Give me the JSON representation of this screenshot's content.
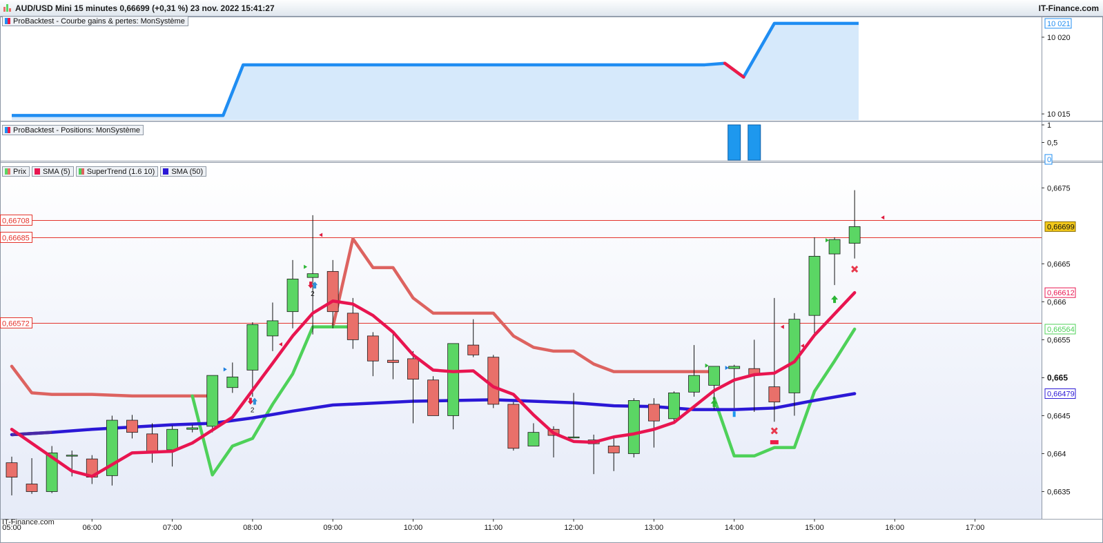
{
  "header": {
    "title": "AUD/USD Mini 15 minutes 0,66699 (+0,31 %) 23 nov. 2022 15:41:27",
    "brand": "IT-Finance.com"
  },
  "watermark": "IT-Finance.com",
  "panels": {
    "equity_label": "ProBacktest - Courbe gains & pertes: MonSystème",
    "positions_label": "ProBacktest - Positions: MonSystème"
  },
  "legend": {
    "price": "Prix",
    "sma5": "SMA (5)",
    "supertrend": "SuperTrend (1.6 10)",
    "sma50": "SMA (50)"
  },
  "colors": {
    "background": "#e6ebf8",
    "equity_line": "#1f8df2",
    "equity_fill": "#d6e9fb",
    "equity_loss": "#ee1b48",
    "bull_candle": "#5bd664",
    "bear_candle": "#e9706a",
    "sma5": "#e81550",
    "sma5_dark": "#c4123e",
    "sma50": "#2b18d6",
    "supertrend_up": "#4ed159",
    "supertrend_down": "#dd6360",
    "hline": "#e4332b",
    "position_bar": "#1e98ee"
  },
  "chart_data": [
    {
      "name": "equity",
      "type": "area",
      "y_ticks": [
        "10 020",
        "10 015"
      ],
      "current_value": "10 021",
      "x": [
        "05:00",
        "07:38",
        "07:53",
        "13:38",
        "13:53",
        "14:07",
        "14:30",
        "17:30"
      ],
      "values": [
        10014.9,
        10014.9,
        10018.2,
        10018.2,
        10018.3,
        10017.4,
        10020.9,
        10020.9
      ],
      "loss_segment": [
        "13:53",
        "14:07"
      ],
      "ylim": [
        10014.6,
        10021.3
      ]
    },
    {
      "name": "positions",
      "type": "bar",
      "y_ticks": [
        "1",
        "0,5"
      ],
      "current_value": "0",
      "bars": [
        {
          "x": "14:00",
          "value": 1
        },
        {
          "x": "14:15",
          "value": 1
        }
      ],
      "ylim": [
        0,
        1
      ]
    },
    {
      "name": "price",
      "type": "candlestick",
      "x_ticks": [
        "05:00",
        "06:00",
        "07:00",
        "08:00",
        "09:00",
        "10:00",
        "11:00",
        "12:00",
        "13:00",
        "14:00",
        "15:00",
        "16:00",
        "17:00"
      ],
      "y_ticks": [
        "0,6675",
        "0,6665",
        "0,666",
        "0,6655",
        "0,665",
        "0,6645",
        "0,664",
        "0,6635"
      ],
      "ylim": [
        0.66315,
        0.66783
      ],
      "current_price": "0,66699",
      "price_labels": [
        {
          "value": "0,66612",
          "color": "#e81550"
        },
        {
          "value": "0,66564",
          "color": "#4ed159"
        },
        {
          "value": "0,66479",
          "color": "#2b18d6"
        }
      ],
      "horizontal_lines": [
        {
          "label": "0,66708",
          "value": 0.66708
        },
        {
          "label": "0,66685",
          "value": 0.66685
        },
        {
          "label": "0,66572",
          "value": 0.66572
        }
      ],
      "candles": [
        {
          "t": "05:00",
          "o": 0.66388,
          "h": 0.66396,
          "l": 0.66345,
          "c": 0.66369
        },
        {
          "t": "05:15",
          "o": 0.6636,
          "h": 0.66394,
          "l": 0.66347,
          "c": 0.6635
        },
        {
          "t": "05:30",
          "o": 0.6635,
          "h": 0.6641,
          "l": 0.66348,
          "c": 0.66401
        },
        {
          "t": "05:45",
          "o": 0.66398,
          "h": 0.66404,
          "l": 0.6637,
          "c": 0.66398
        },
        {
          "t": "06:00",
          "o": 0.66393,
          "h": 0.66398,
          "l": 0.6636,
          "c": 0.66369
        },
        {
          "t": "06:15",
          "o": 0.66371,
          "h": 0.6645,
          "l": 0.66358,
          "c": 0.66444
        },
        {
          "t": "06:30",
          "o": 0.66444,
          "h": 0.66451,
          "l": 0.6642,
          "c": 0.66428
        },
        {
          "t": "06:45",
          "o": 0.66426,
          "h": 0.6644,
          "l": 0.66388,
          "c": 0.66403
        },
        {
          "t": "07:00",
          "o": 0.66405,
          "h": 0.66437,
          "l": 0.66383,
          "c": 0.66432
        },
        {
          "t": "07:15",
          "o": 0.66432,
          "h": 0.66438,
          "l": 0.66428,
          "c": 0.66434
        },
        {
          "t": "07:30",
          "o": 0.66436,
          "h": 0.66503,
          "l": 0.66428,
          "c": 0.66503
        },
        {
          "t": "07:45",
          "o": 0.66487,
          "h": 0.6652,
          "l": 0.6648,
          "c": 0.66501
        },
        {
          "t": "08:00",
          "o": 0.6651,
          "h": 0.66573,
          "l": 0.66475,
          "c": 0.6657
        },
        {
          "t": "08:15",
          "o": 0.66555,
          "h": 0.66599,
          "l": 0.66535,
          "c": 0.66575
        },
        {
          "t": "08:30",
          "o": 0.66587,
          "h": 0.66655,
          "l": 0.66565,
          "c": 0.6663
        },
        {
          "t": "08:45",
          "o": 0.66632,
          "h": 0.66714,
          "l": 0.66557,
          "c": 0.66637
        },
        {
          "t": "09:00",
          "o": 0.6664,
          "h": 0.66655,
          "l": 0.66565,
          "c": 0.66587
        },
        {
          "t": "09:15",
          "o": 0.66585,
          "h": 0.66605,
          "l": 0.66538,
          "c": 0.6655
        },
        {
          "t": "09:30",
          "o": 0.66555,
          "h": 0.6656,
          "l": 0.66502,
          "c": 0.66522
        },
        {
          "t": "09:45",
          "o": 0.66523,
          "h": 0.6656,
          "l": 0.66498,
          "c": 0.6652
        },
        {
          "t": "10:00",
          "o": 0.66525,
          "h": 0.66535,
          "l": 0.6644,
          "c": 0.66498
        },
        {
          "t": "10:15",
          "o": 0.66497,
          "h": 0.66502,
          "l": 0.6645,
          "c": 0.6645
        },
        {
          "t": "10:30",
          "o": 0.6645,
          "h": 0.66545,
          "l": 0.66432,
          "c": 0.66545
        },
        {
          "t": "10:45",
          "o": 0.66543,
          "h": 0.66577,
          "l": 0.66527,
          "c": 0.6653
        },
        {
          "t": "11:00",
          "o": 0.66527,
          "h": 0.6653,
          "l": 0.6646,
          "c": 0.66465
        },
        {
          "t": "11:15",
          "o": 0.66465,
          "h": 0.66468,
          "l": 0.66404,
          "c": 0.66407
        },
        {
          "t": "11:30",
          "o": 0.6641,
          "h": 0.6644,
          "l": 0.6641,
          "c": 0.66428
        },
        {
          "t": "11:45",
          "o": 0.66432,
          "h": 0.66436,
          "l": 0.66395,
          "c": 0.66424
        },
        {
          "t": "12:00",
          "o": 0.66422,
          "h": 0.6648,
          "l": 0.6642,
          "c": 0.66422
        },
        {
          "t": "12:15",
          "o": 0.66418,
          "h": 0.66425,
          "l": 0.66373,
          "c": 0.66413
        },
        {
          "t": "12:30",
          "o": 0.6641,
          "h": 0.6642,
          "l": 0.66377,
          "c": 0.66401
        },
        {
          "t": "12:45",
          "o": 0.664,
          "h": 0.66473,
          "l": 0.66395,
          "c": 0.6647
        },
        {
          "t": "13:00",
          "o": 0.66465,
          "h": 0.66473,
          "l": 0.66408,
          "c": 0.66443
        },
        {
          "t": "13:15",
          "o": 0.66446,
          "h": 0.66482,
          "l": 0.6644,
          "c": 0.6648
        },
        {
          "t": "13:30",
          "o": 0.66481,
          "h": 0.66543,
          "l": 0.66475,
          "c": 0.66503
        },
        {
          "t": "13:45",
          "o": 0.6649,
          "h": 0.66515,
          "l": 0.66458,
          "c": 0.66515
        },
        {
          "t": "14:00",
          "o": 0.66512,
          "h": 0.66517,
          "l": 0.6646,
          "c": 0.66515
        },
        {
          "t": "14:15",
          "o": 0.66512,
          "h": 0.6655,
          "l": 0.66455,
          "c": 0.66503
        },
        {
          "t": "14:30",
          "o": 0.66488,
          "h": 0.66605,
          "l": 0.66442,
          "c": 0.66468
        },
        {
          "t": "14:45",
          "o": 0.6648,
          "h": 0.66585,
          "l": 0.6645,
          "c": 0.66577
        },
        {
          "t": "15:00",
          "o": 0.66582,
          "h": 0.66685,
          "l": 0.66555,
          "c": 0.6666
        },
        {
          "t": "15:15",
          "o": 0.66663,
          "h": 0.66685,
          "l": 0.66622,
          "c": 0.66682
        },
        {
          "t": "15:30",
          "o": 0.66677,
          "h": 0.66747,
          "l": 0.66657,
          "c": 0.66699
        }
      ],
      "sma5": {
        "name": "SMA (5)",
        "x": [
          "05:00",
          "05:45",
          "06:00",
          "06:30",
          "07:00",
          "07:15",
          "07:45",
          "08:15",
          "08:30",
          "08:45",
          "09:00",
          "09:15",
          "09:30",
          "09:45",
          "10:00",
          "10:15",
          "10:30",
          "10:45",
          "11:00",
          "11:15",
          "11:30",
          "11:45",
          "12:00",
          "12:15",
          "12:30",
          "12:45",
          "13:00",
          "13:15",
          "13:30",
          "13:45",
          "14:00",
          "14:15",
          "14:30",
          "14:45",
          "15:00",
          "15:30"
        ],
        "values": [
          0.66432,
          0.66377,
          0.6637,
          0.66401,
          0.66403,
          0.66414,
          0.66448,
          0.66519,
          0.66555,
          0.66585,
          0.66601,
          0.66597,
          0.66582,
          0.6656,
          0.6653,
          0.6651,
          0.66508,
          0.66509,
          0.66488,
          0.66478,
          0.66451,
          0.66427,
          0.66416,
          0.66415,
          0.66422,
          0.66426,
          0.66432,
          0.66441,
          0.66462,
          0.66483,
          0.66497,
          0.66504,
          0.66506,
          0.66521,
          0.66556,
          0.66612
        ],
        "dark_range": [
          "05:00",
          "06:15"
        ]
      },
      "sma50": {
        "name": "SMA (50)",
        "x": [
          "05:00",
          "05:30",
          "06:00",
          "06:30",
          "07:00",
          "07:30",
          "08:00",
          "08:30",
          "09:00",
          "10:00",
          "11:00",
          "12:00",
          "12:30",
          "13:00",
          "13:30",
          "14:00",
          "14:30",
          "15:00",
          "15:30"
        ],
        "values": [
          0.66425,
          0.66428,
          0.66432,
          0.66435,
          0.66438,
          0.6644,
          0.66447,
          0.66456,
          0.66464,
          0.66469,
          0.66471,
          0.66467,
          0.66463,
          0.66462,
          0.66458,
          0.66458,
          0.6646,
          0.6647,
          0.66479
        ],
        "dark_range": [
          "05:00",
          "05:30"
        ]
      },
      "supertrend": {
        "name": "SuperTrend (1.6 10)",
        "down_segments": [
          {
            "x": [
              "05:00",
              "05:15",
              "05:30",
              "06:00",
              "06:30",
              "07:00",
              "07:15",
              "07:30"
            ],
            "values": [
              0.66515,
              0.6648,
              0.66478,
              0.66478,
              0.66476,
              0.66476,
              0.66476,
              0.66476
            ]
          },
          {
            "x": [
              "09:00",
              "09:15",
              "09:30",
              "09:45",
              "10:00",
              "10:15",
              "10:30",
              "10:45",
              "11:00",
              "11:15",
              "11:30",
              "11:45",
              "12:00",
              "12:15",
              "12:30",
              "12:45",
              "13:00",
              "13:15",
              "13:30",
              "13:45"
            ],
            "values": [
              0.66567,
              0.66683,
              0.66645,
              0.66645,
              0.66605,
              0.66585,
              0.66585,
              0.66585,
              0.66585,
              0.66555,
              0.6654,
              0.66535,
              0.66535,
              0.66518,
              0.66508,
              0.66508,
              0.66508,
              0.66508,
              0.66508,
              0.66508
            ]
          }
        ],
        "up_segments": [
          {
            "x": [
              "07:15",
              "07:30",
              "07:45",
              "08:00",
              "08:15",
              "08:30",
              "08:45",
              "09:00",
              "09:15"
            ],
            "values": [
              0.66476,
              0.66372,
              0.6641,
              0.6642,
              0.66465,
              0.66505,
              0.66567,
              0.66567,
              0.66567
            ]
          },
          {
            "x": [
              "13:45",
              "14:00",
              "14:15",
              "14:30",
              "14:45",
              "15:00",
              "15:15",
              "15:30"
            ],
            "values": [
              0.66473,
              0.66397,
              0.66397,
              0.66408,
              0.66408,
              0.66482,
              0.66522,
              0.66564
            ]
          }
        ]
      },
      "signals": [
        {
          "t": "08:00",
          "kind": "down-up-2",
          "value": 0.66469
        },
        {
          "t": "07:45",
          "kind": "tri-right-blue",
          "value": 0.66511
        },
        {
          "t": "08:15",
          "kind": "tri-left-red",
          "value": 0.66544
        },
        {
          "t": "08:45",
          "kind": "down-up-2",
          "value": 0.66622
        },
        {
          "t": "08:45",
          "kind": "tri-right-green",
          "value": 0.66646
        },
        {
          "t": "08:45",
          "kind": "tri-left-red",
          "value": 0.66688
        },
        {
          "t": "13:45",
          "kind": "up-green",
          "value": 0.66466
        },
        {
          "t": "13:45",
          "kind": "tri-right-green",
          "value": 0.66516
        },
        {
          "t": "14:00",
          "kind": "tri-right-blue",
          "value": 0.66513
        },
        {
          "t": "14:00",
          "kind": "bar-blue",
          "value": 0.66452
        },
        {
          "t": "14:30",
          "kind": "x-red",
          "value": 0.6643
        },
        {
          "t": "14:30",
          "kind": "rect-red",
          "value": 0.66415
        },
        {
          "t": "14:30",
          "kind": "tri-left-red",
          "value": 0.66567
        },
        {
          "t": "14:45",
          "kind": "tri-left-red",
          "value": 0.66542
        },
        {
          "t": "15:15",
          "kind": "tri-right-green",
          "value": 0.66681
        },
        {
          "t": "15:15",
          "kind": "up-green",
          "value": 0.66603
        },
        {
          "t": "15:30",
          "kind": "x-red",
          "value": 0.66643
        },
        {
          "t": "15:45",
          "kind": "tri-left-red",
          "value": 0.66711
        }
      ]
    }
  ]
}
